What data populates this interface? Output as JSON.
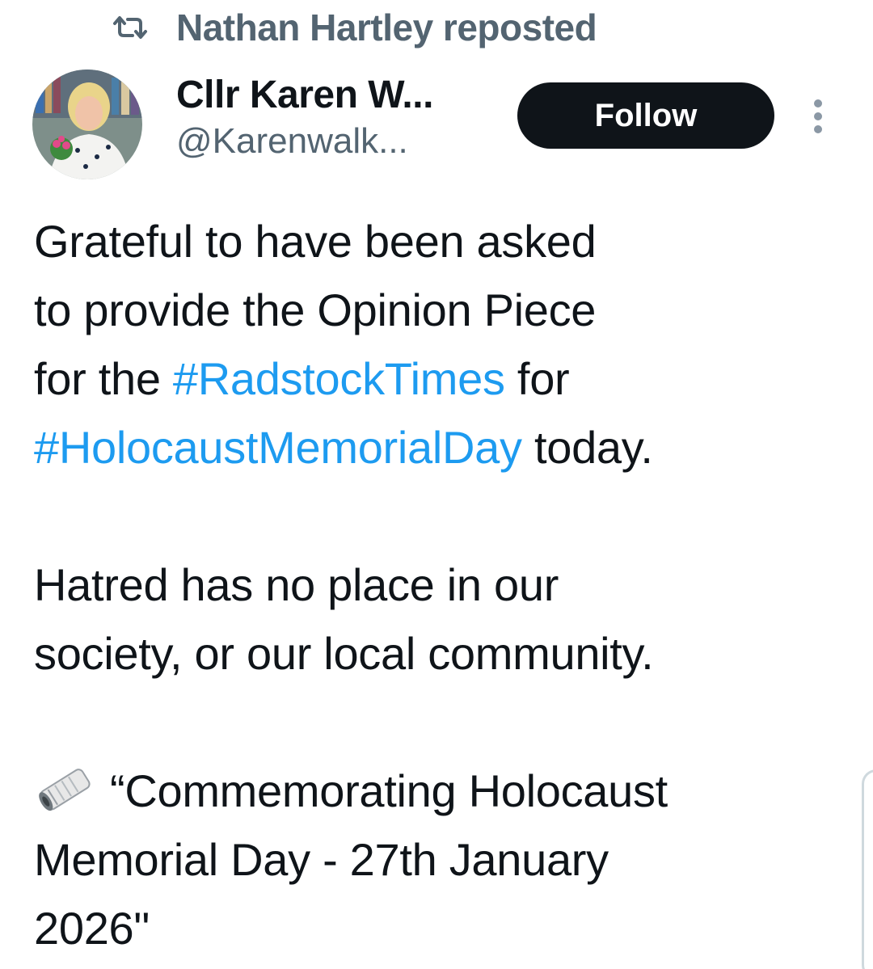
{
  "repost": {
    "icon": "repost-icon",
    "text": "Nathan Hartley reposted"
  },
  "author": {
    "display_name": "Cllr Karen W...",
    "handle": "@Karenwalk..."
  },
  "follow_label": "Follow",
  "tweet": {
    "line1": "Grateful to have been asked",
    "line2": "to provide the Opinion Piece",
    "line3_prefix": "for the ",
    "hashtag1": "#RadstockTimes",
    "line3_suffix": " for",
    "hashtag2": "#HolocaustMemorialDay",
    "line4_suffix": " today.",
    "line5": "Hatred has no place in our",
    "line6": "society, or our local community.",
    "line7": "“Commemorating Holocaust",
    "line8": "Memorial Day - 27th January",
    "line9": "2026\""
  },
  "colors": {
    "link": "#1d9bf0",
    "text": "#0f1419",
    "muted": "#536471",
    "button": "#0f1419"
  }
}
